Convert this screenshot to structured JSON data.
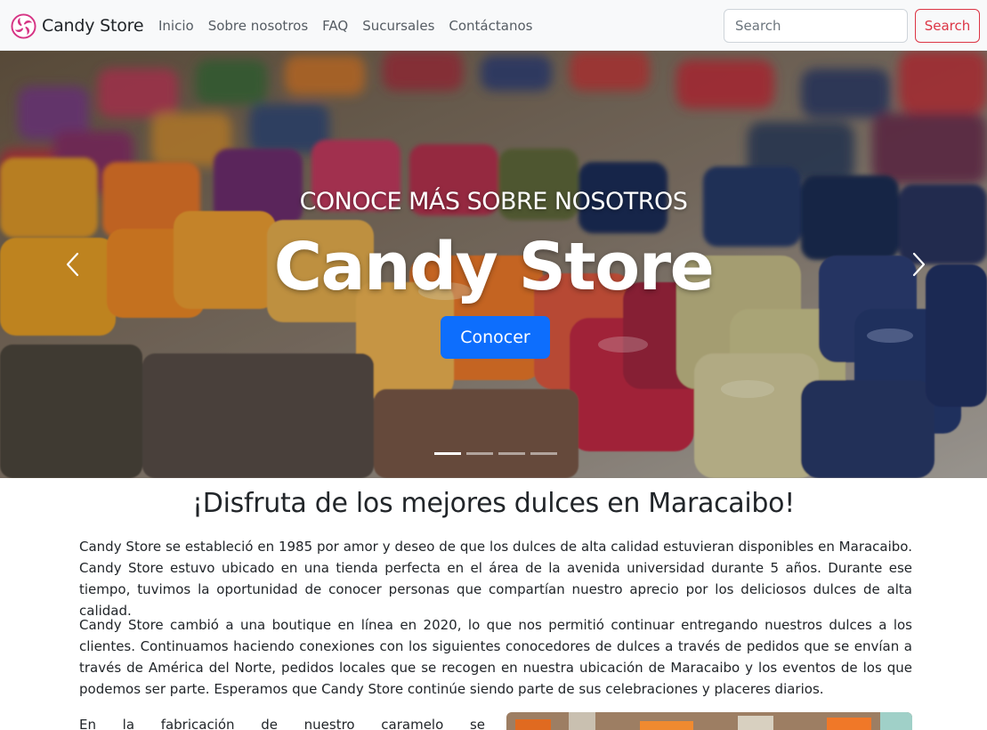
{
  "nav": {
    "brand": "Candy Store",
    "links": [
      "Inicio",
      "Sobre nosotros",
      "FAQ",
      "Sucursales",
      "Contáctanos"
    ],
    "search_placeholder": "Search",
    "search_button": "Search"
  },
  "hero": {
    "subtitle": "CONOCE MÁS SOBRE NOSOTROS",
    "title": "Candy Store",
    "button": "Conocer",
    "slides_total": 4,
    "active_slide": 1
  },
  "content": {
    "heading": "¡Disfruta de los mejores dulces en Maracaibo!",
    "paragraphs": [
      "Candy Store se estableció en 1985 por amor y deseo de que los dulces de alta calidad estuvieran disponibles en Maracaibo. Candy Store estuvo ubicado en una tienda perfecta en el área de la avenida universidad durante 5 años. Durante ese tiempo, tuvimos la oportunidad de conocer personas que compartían nuestro aprecio por los deliciosos dulces de alta calidad.",
      "Candy Store cambió a una boutique en línea en 2020, lo que nos permitió continuar entregando nuestros dulces a los clientes. Continuamos haciendo conexiones con los siguientes conocedores de dulces a través de pedidos que se envían a través de América del Norte, pedidos locales que se recogen en nuestra ubicación de Maracaibo y los eventos de los que podemos ser parte. Esperamos que Candy Store continúe siendo parte de sus celebraciones y placeres diarios.",
      "En la fabricación de nuestro caramelo se usan como"
    ]
  },
  "colors": {
    "primary": "#0d6efd",
    "danger": "#dc3545",
    "navbar_bg": "#f8f9fa"
  }
}
